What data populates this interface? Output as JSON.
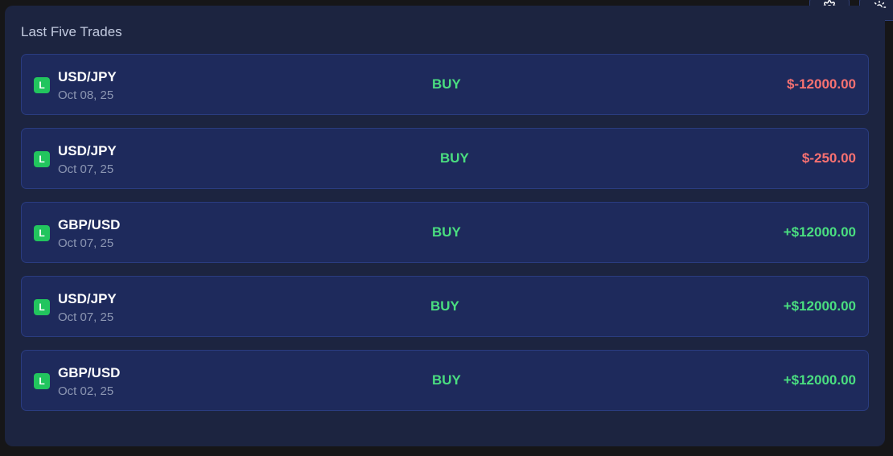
{
  "panel": {
    "title": "Last Five Trades"
  },
  "toolbar": {
    "settings_icon": "gear-icon",
    "theme_icon": "sun-icon"
  },
  "trades": [
    {
      "badge": "L",
      "pair": "USD/JPY",
      "date": "Oct 08, 25",
      "side": "BUY",
      "pnl": "$-12000.00",
      "pnl_sign": "negative"
    },
    {
      "badge": "L",
      "pair": "USD/JPY",
      "date": "Oct 07, 25",
      "side": "BUY",
      "pnl": "$-250.00",
      "pnl_sign": "negative"
    },
    {
      "badge": "L",
      "pair": "GBP/USD",
      "date": "Oct 07, 25",
      "side": "BUY",
      "pnl": "+$12000.00",
      "pnl_sign": "positive"
    },
    {
      "badge": "L",
      "pair": "USD/JPY",
      "date": "Oct 07, 25",
      "side": "BUY",
      "pnl": "+$12000.00",
      "pnl_sign": "positive"
    },
    {
      "badge": "L",
      "pair": "GBP/USD",
      "date": "Oct 02, 25",
      "side": "BUY",
      "pnl": "+$12000.00",
      "pnl_sign": "positive"
    }
  ],
  "colors": {
    "positive": "#4ade80",
    "negative": "#f87171",
    "badge": "#22c55e",
    "card": "#1e2a5c",
    "panel": "#1c2440"
  }
}
